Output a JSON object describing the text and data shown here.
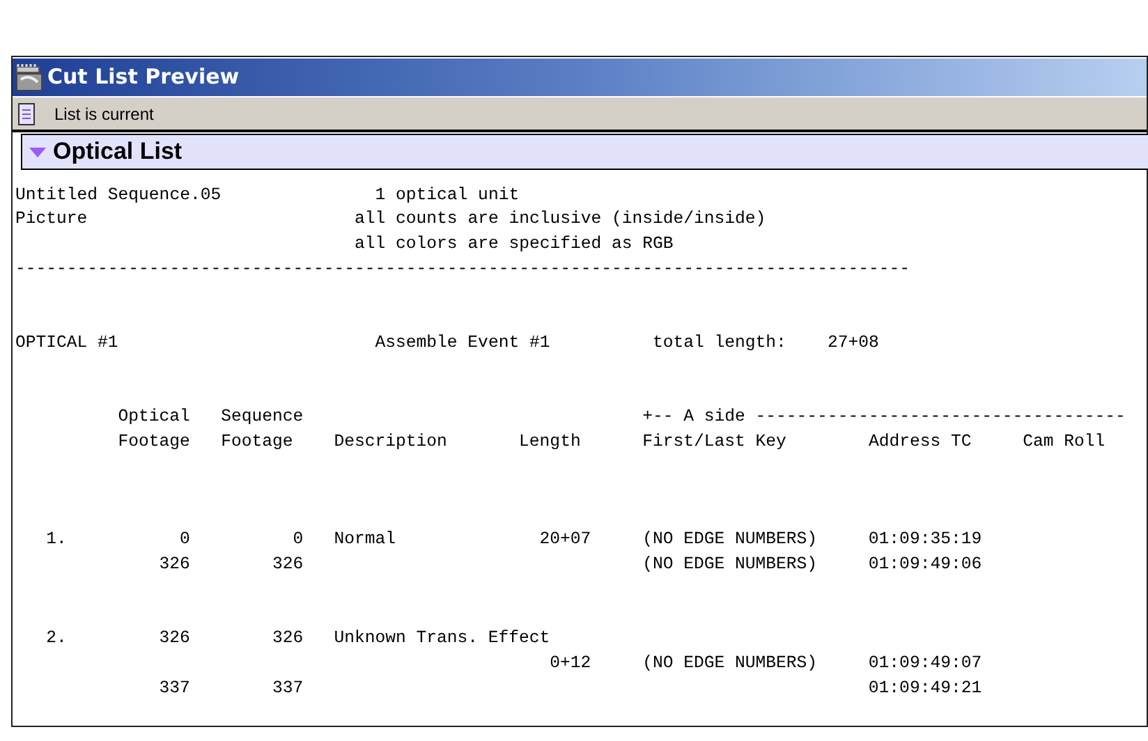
{
  "window": {
    "title": "Cut List Preview"
  },
  "status_bar": {
    "text": "List is current"
  },
  "section": {
    "title": "Optical List",
    "expanded": true
  },
  "report": {
    "header": [
      {
        "left": "Untitled Sequence.05",
        "right": "1 optical unit"
      },
      {
        "left": "Picture",
        "right": "all counts are inclusive (inside/inside)"
      },
      {
        "right": "all colors are specified as RGB"
      }
    ],
    "separator": "---------------------------------------------------------------------------------------",
    "optical": {
      "label": "OPTICAL #1",
      "event": "Assemble Event #1",
      "total_label": "total length:",
      "total_value": "27+08"
    },
    "columns_top": [
      "Optical",
      "Sequence",
      "+-- A side ------------------------------------"
    ],
    "columns": [
      "Footage",
      "Footage",
      "Description",
      "Length",
      "First/Last Key",
      "Address TC",
      "Cam Roll"
    ],
    "rows": [
      {
        "lines": [
          {
            "number": "1.",
            "optical_footage": "0",
            "sequence_footage": "0",
            "description": "Normal",
            "length": "20+07",
            "key": "(NO EDGE NUMBERS)",
            "address": "01:09:35:19"
          },
          {
            "optical_footage": "326",
            "sequence_footage": "326",
            "key": "(NO EDGE NUMBERS)",
            "address": "01:09:49:06"
          }
        ]
      },
      {
        "lines": [
          {
            "number": "2.",
            "optical_footage": "326",
            "sequence_footage": "326",
            "description": "Unknown Trans. Effect"
          },
          {
            "length": "0+12",
            "key": "(NO EDGE NUMBERS)",
            "address": "01:09:49:07"
          },
          {
            "optical_footage": "337",
            "sequence_footage": "337",
            "address": "01:09:49:21"
          }
        ]
      }
    ]
  }
}
